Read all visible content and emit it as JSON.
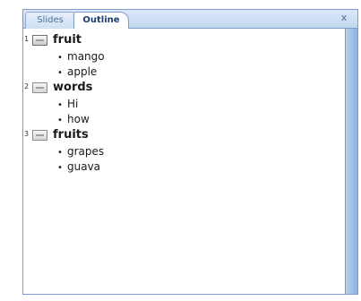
{
  "tabs": [
    {
      "label": "Slides",
      "active": false
    },
    {
      "label": "Outline",
      "active": true
    }
  ],
  "close_label": "x",
  "bullet_char": "•",
  "slides": [
    {
      "number": "1",
      "title": "fruit",
      "bullets": [
        "mango",
        "apple"
      ]
    },
    {
      "number": "2",
      "title": "words",
      "bullets": [
        "Hi",
        "how"
      ]
    },
    {
      "number": "3",
      "title": "fruits",
      "bullets": [
        "grapes",
        "guava"
      ]
    }
  ],
  "colors": {
    "pane_frame": "#7d9cc8",
    "tab_active_text": "#1e3d6e",
    "tab_inactive_text": "#4a6f9e",
    "scrollbar": "#a9c3e6"
  }
}
